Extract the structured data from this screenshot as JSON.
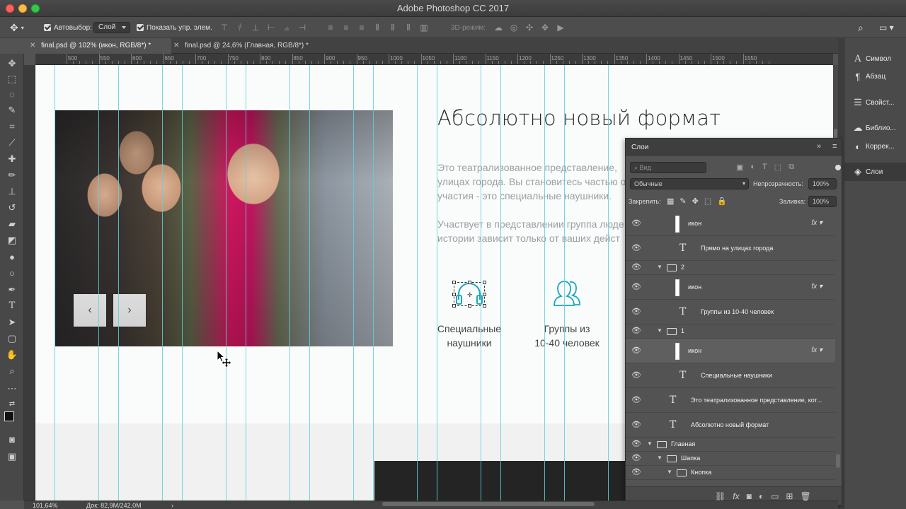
{
  "window": {
    "title": "Adobe Photoshop CC 2017"
  },
  "options": {
    "autoselect_label": "Автовыбор:",
    "autoselect_value": "Слой",
    "show_controls_label": "Показать упр. элем.",
    "mode_3d_label": "3D-режим:"
  },
  "tabs": [
    {
      "label": "final.psd @ 102% (икон, RGB/8*) *",
      "close": "✕"
    },
    {
      "label": "final.psd @ 24,6% (Главная, RGB/8*) *",
      "close": "✕"
    }
  ],
  "ruler": {
    "marks": [
      "500",
      "550",
      "600",
      "650",
      "700",
      "750",
      "800",
      "850",
      "900",
      "950",
      "1000",
      "1050",
      "1100",
      "1150",
      "1200",
      "1250",
      "1300",
      "1350",
      "1400",
      "1450",
      "1500",
      "1550"
    ]
  },
  "canvas": {
    "heading": "Абсолютно новый формат",
    "para1_line1": "Это театрализованное представление,",
    "para1_line2": "улицах города. Вы становитесь частью о",
    "para1_line3": "участия - это специальные наушники.",
    "para2_line1": "Участвует в представлении группа люде",
    "para2_line2": "истории зависит только от ваших дейст",
    "feature1_line1": "Специальные",
    "feature1_line2": "наушники",
    "feature2_line1": "Группы из",
    "feature2_line2": "10-40 человек",
    "prev_arrow": "‹",
    "next_arrow": "›",
    "accent_color": "#1aa7bd"
  },
  "dock": {
    "items": [
      {
        "label": "Символ",
        "icon": "character-icon"
      },
      {
        "label": "Абзац",
        "icon": "paragraph-icon"
      },
      {
        "label": "Свойст...",
        "icon": "properties-icon"
      },
      {
        "label": "Библио...",
        "icon": "libraries-icon"
      },
      {
        "label": "Коррек...",
        "icon": "adjustments-icon"
      },
      {
        "label": "Слои",
        "icon": "layers-icon"
      }
    ]
  },
  "layers_panel": {
    "title": "Слои",
    "search_placeholder": "Вид",
    "blend_mode": "Обычные",
    "opacity_label": "Непрозрачность:",
    "opacity_value": "100%",
    "lock_label": "Закрепить:",
    "fill_label": "Заливка:",
    "fill_value": "100%",
    "layers": [
      {
        "name": "икон",
        "kind": "shape",
        "fx": "fx",
        "indent": 2
      },
      {
        "name": "Прямо на улицах города",
        "kind": "text",
        "indent": 2
      },
      {
        "name": "2",
        "kind": "group",
        "indent": 1
      },
      {
        "name": "икон",
        "kind": "shape",
        "fx": "fx",
        "indent": 2
      },
      {
        "name": "Группы из 10-40 человек",
        "kind": "text",
        "indent": 2
      },
      {
        "name": "1",
        "kind": "group",
        "indent": 1
      },
      {
        "name": "икон",
        "kind": "shape",
        "fx": "fx",
        "indent": 2,
        "selected": true
      },
      {
        "name": "Специальные наушники",
        "kind": "text",
        "indent": 2
      },
      {
        "name": "Это театрализованное представление, кот...",
        "kind": "text",
        "indent": 1
      },
      {
        "name": "Абсолютно новый формат",
        "kind": "text",
        "indent": 1
      },
      {
        "name": "Главная",
        "kind": "group",
        "indent": 0
      },
      {
        "name": "Шапка",
        "kind": "group",
        "indent": 1
      },
      {
        "name": "Кнопка",
        "kind": "group",
        "indent": 2
      }
    ]
  },
  "status": {
    "zoom": "101,64%",
    "doc": "Док: 82,9M/242,0M"
  }
}
